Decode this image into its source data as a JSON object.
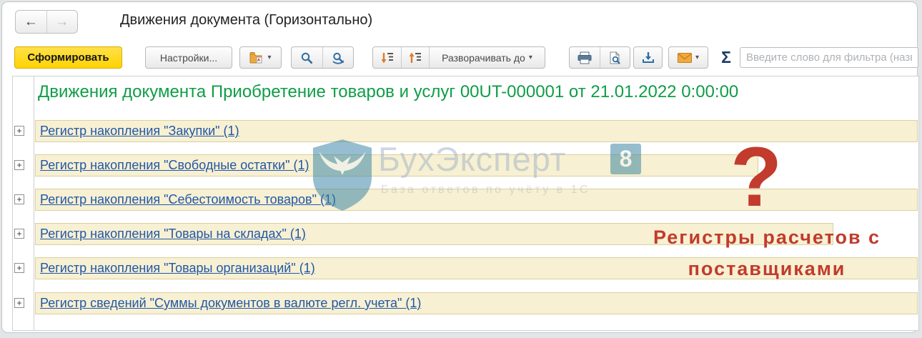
{
  "window": {
    "title": "Движения документа (Горизонтально)"
  },
  "icons": {
    "back": "←",
    "forward": "→",
    "caret": "▾",
    "plus": "+"
  },
  "toolbar": {
    "generate_label": "Сформировать",
    "settings_label": "Настройки...",
    "expand_to_label": "Разворачивать до",
    "sigma_label": "Σ",
    "filter_placeholder": "Введите слово для фильтра (назв"
  },
  "report": {
    "title": "Движения документа Приобретение товаров и услуг 00UT-000001 от 21.01.2022 0:00:00",
    "rows": [
      {
        "label": "Регистр накопления \"Закупки\" (1)"
      },
      {
        "label": "Регистр накопления \"Свободные остатки\" (1)"
      },
      {
        "label": "Регистр накопления \"Себестоимость товаров\" (1)"
      },
      {
        "label": "Регистр накопления \"Товары на складах\" (1)"
      },
      {
        "label": "Регистр накопления \"Товары организаций\" (1)"
      },
      {
        "label": "Регистр сведений \"Суммы документов в валюте регл. учета\" (1)"
      }
    ]
  },
  "watermark": {
    "brand": "БухЭксперт",
    "badge": "8",
    "tagline": "База ответов по учёту в 1С"
  },
  "annotation": {
    "question_mark": "?",
    "line1": "Регистры расчетов с",
    "line2": "поставщиками"
  },
  "colors": {
    "accent_yellow": "#ffd300",
    "link_blue": "#2257a8",
    "report_green": "#0f9d47",
    "annotation_red": "#c23b2c",
    "row_cream": "#f7f0d2"
  }
}
